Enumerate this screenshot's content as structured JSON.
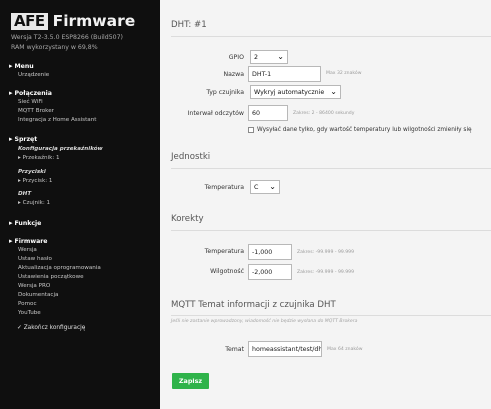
{
  "sidebar": {
    "logo_box": "AFE",
    "logo_text": "Firmware",
    "version": "Wersja T2-3.5.0 ESP8266 (Build507)",
    "ram": "RAM wykorzystany w 69,8%",
    "menu": {
      "title": "Menu",
      "items": [
        "Urządzenie"
      ]
    },
    "connections": {
      "title": "Połączenia",
      "items": [
        "Sieć WiFi",
        "MQTT Broker",
        "Integracja z Home Assistant"
      ]
    },
    "hardware": {
      "title": "Sprzęt",
      "relays_title": "Konfiguracja przekaźników",
      "relays_item": "Przekaźnik: 1",
      "buttons_title": "Przyciski",
      "buttons_item": "Przycisk: 1",
      "dht_title": "DHT",
      "dht_item": "Czujnik: 1"
    },
    "functions": {
      "title": "Funkcje"
    },
    "firmware": {
      "title": "Firmware",
      "items": [
        "Wersja",
        "Ustaw hasło",
        "Aktualizacja oprogramowania",
        "Ustawienia początkowe",
        "Wersja PRO",
        "Dokumentacja",
        "Pomoc",
        "YouTube"
      ]
    },
    "finish": "Zakończ konfigurację"
  },
  "main": {
    "title": "DHT: #1",
    "gpio_label": "GPIO",
    "gpio_value": "2",
    "name_label": "Nazwa",
    "name_value": "DHT-1",
    "name_hint": "Max 32 znaków",
    "type_label": "Typ czujnika",
    "type_value": "Wykryj automatycznie",
    "interval_label": "Interwał odczytów",
    "interval_value": "60",
    "interval_hint": "Zakres: 2 - 86400 sekundy",
    "send_only_label": "Wysyłać dane tylko, gdy wartość temperatury lub wilgotności zmieniły się",
    "units_title": "Jednostki",
    "temp_unit_label": "Temperatura",
    "temp_unit_value": "C",
    "corrections_title": "Korekty",
    "temp_corr_label": "Temperatura",
    "temp_corr_value": "-1,000",
    "temp_corr_hint": "Zakres: -99.999 - 99.999",
    "hum_corr_label": "Wilgotność",
    "hum_corr_value": "-2,000",
    "hum_corr_hint": "Zakres: -99.999 - 99.999",
    "mqtt_title": "MQTT Temat informacji z czujnika DHT",
    "mqtt_desc": "Jeśli nie zostanie wprowadzony, wiadomość nie będzie wysłana do MQTT Brokera",
    "topic_label": "Temat",
    "topic_value": "homeassistant/test/dht",
    "topic_hint": "Max 64 znaków",
    "save_label": "Zapisz"
  }
}
